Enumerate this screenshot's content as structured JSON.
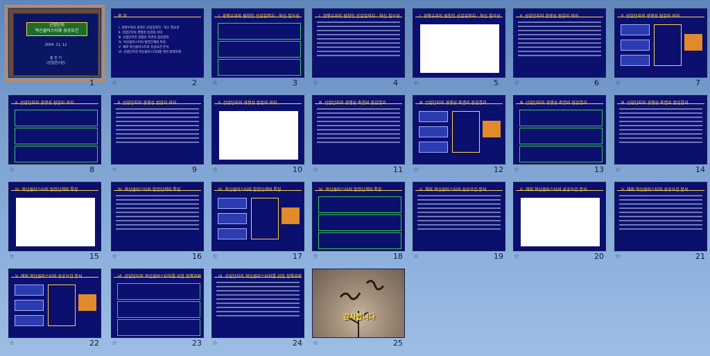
{
  "app": {
    "view": "slide-sorter"
  },
  "slides": [
    {
      "num": "1",
      "title": "",
      "cover": {
        "heading": "산업단지\n혁신클러스터화 성공요건",
        "date": "2004. 11. 12",
        "presenter": "홍 진 기",
        "org": "(산업연구원)"
      }
    },
    {
      "num": "2",
      "title": "목 차",
      "toc": [
        "Ⅰ. 경쟁우위의 원천인 산업집적지 : 혁신 필요성",
        "Ⅱ. 산업단지의 경쟁성 점검의 의의",
        "Ⅲ. 산업단지의 경쟁성 측면의 점검결과",
        "Ⅳ. 혁신클러스터의 발전단계와 특징",
        "Ⅴ. 해외 혁신클러스터의 성공요건 분석",
        "Ⅵ. 산업단지의 혁신클러스터화를 위한 정책과제"
      ]
    },
    {
      "num": "3",
      "title": "Ⅰ. 경쟁우위의 원천인 산업집적지 : 혁신 필요성"
    },
    {
      "num": "4",
      "title": "Ⅰ. 경쟁우위의 원천인 산업집적지 : 혁신 필요성"
    },
    {
      "num": "5",
      "title": "Ⅰ. 경쟁우위의 원천인 산업집적지 : 혁신 필요성"
    },
    {
      "num": "6",
      "title": "Ⅱ. 산업단지의 경쟁성 점검의 의의"
    },
    {
      "num": "7",
      "title": "Ⅱ. 산업단지의 경쟁성 점검의 의의"
    },
    {
      "num": "8",
      "title": "Ⅱ. 산업단지의 경쟁성 점검의 의의"
    },
    {
      "num": "9",
      "title": "Ⅱ. 산업단지의 경쟁성 점검의 의의"
    },
    {
      "num": "10",
      "title": "Ⅱ. 산업단지의 경쟁성 점검의 의의"
    },
    {
      "num": "11",
      "title": "Ⅲ. 산업단지의 경쟁성 측면의 점검결과"
    },
    {
      "num": "12",
      "title": "Ⅲ. 산업단지의 경쟁성 측면의 점검결과"
    },
    {
      "num": "13",
      "title": "Ⅲ. 산업단지의 경쟁성 측면의 점검결과"
    },
    {
      "num": "14",
      "title": "Ⅲ. 산업단지의 경쟁성 측면의 점검결과"
    },
    {
      "num": "15",
      "title": "Ⅳ. 혁신클러스터의 발전단계와 특징"
    },
    {
      "num": "16",
      "title": "Ⅳ. 혁신클러스터의 발전단계와 특징"
    },
    {
      "num": "17",
      "title": "Ⅳ. 혁신클러스터의 발전단계와 특징"
    },
    {
      "num": "18",
      "title": "Ⅳ. 혁신클러스터의 발전단계와 특징"
    },
    {
      "num": "19",
      "title": "Ⅴ. 해외 혁신클러스터의 성공요건 분석"
    },
    {
      "num": "20",
      "title": "Ⅴ. 해외 혁신클러스터의 성공요건 분석"
    },
    {
      "num": "21",
      "title": "Ⅴ. 해외 혁신클러스터의 성공요건 분석"
    },
    {
      "num": "22",
      "title": "Ⅴ. 해외 혁신클러스터의 성공요건 분석"
    },
    {
      "num": "23",
      "title": "Ⅵ. 산업단지의 혁신클러스터화를 위한 정책과제"
    },
    {
      "num": "24",
      "title": "Ⅵ. 산업단지의 혁신클러스터화를 위한 정책과제"
    },
    {
      "num": "25",
      "title": "",
      "ending": "감사합니다"
    }
  ],
  "colors": {
    "slide_bg": "#0b0f6e",
    "accent": "#ffd34a",
    "selected": "#c98a4a",
    "window_bg": "#7a9fcf"
  }
}
